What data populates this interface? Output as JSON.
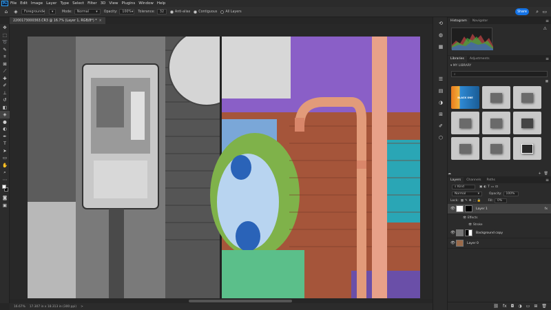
{
  "app": {
    "logo": "Ps"
  },
  "menu": [
    "File",
    "Edit",
    "Image",
    "Layer",
    "Type",
    "Select",
    "Filter",
    "3D",
    "View",
    "Plugins",
    "Window",
    "Help"
  ],
  "options": {
    "sample_value": "Foreground",
    "mode_label": "Mode:",
    "mode_value": "Normal",
    "opacity_label": "Opacity:",
    "opacity_value": "100%",
    "tolerance_label": "Tolerance:",
    "tolerance_value": "32",
    "antialias_label": "Anti-alias",
    "contiguous_label": "Contiguous",
    "all_layers_label": "All Layers",
    "share_label": "Share"
  },
  "document": {
    "tab_title": "2200173000363.CR3 @ 16.7% (Layer 1, RGB/8*) *",
    "close": "×"
  },
  "status": {
    "zoom": "16.67%",
    "size": "17.307 in x 18.313 in (300 ppi)",
    "arrow": ">"
  },
  "panels": {
    "top_tabs": [
      "Histogram",
      "Navigator"
    ],
    "mid_tabs": [
      "Libraries",
      "Adjustments"
    ],
    "library_name": "MY LIBRARY",
    "library_search_placeholder": "",
    "layer_tabs": [
      "Layers",
      "Channels",
      "Paths"
    ],
    "kind_label": "Kind",
    "blend_mode": "Normal",
    "opacity_label": "Opacity:",
    "opacity_value": "100%",
    "lock_label": "Lock:",
    "fill_label": "Fill:",
    "fill_value": "0%",
    "thumb_text": "BLACK ONE",
    "layers": [
      {
        "name": "Layer 1",
        "fx": "fx"
      },
      {
        "name": "Background copy"
      },
      {
        "name": "Layer 0"
      }
    ],
    "effects_label": "Effects",
    "stroke_label": "Stroke"
  }
}
